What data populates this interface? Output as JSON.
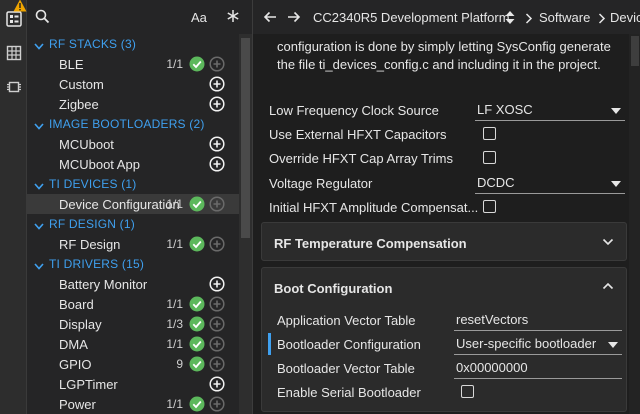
{
  "activity": {
    "items": [
      {
        "name": "Software",
        "icon": "component-tree-icon"
      },
      {
        "name": "Table",
        "icon": "table-icon"
      },
      {
        "name": "Chip",
        "icon": "chip-icon"
      }
    ],
    "warning_icon": "warning-icon"
  },
  "sidebar": {
    "case_toggle": "Aa",
    "groups": [
      {
        "label": "RF STACKS (3)",
        "items": [
          {
            "label": "BLE",
            "count": "1/1",
            "ok": true
          },
          {
            "label": "Custom",
            "count": "",
            "ok": false
          },
          {
            "label": "Zigbee",
            "count": "",
            "ok": false
          }
        ]
      },
      {
        "label": "IMAGE BOOTLOADERS (2)",
        "items": [
          {
            "label": "MCUboot",
            "count": "",
            "ok": false
          },
          {
            "label": "MCUboot App",
            "count": "",
            "ok": false
          }
        ]
      },
      {
        "label": "TI DEVICES (1)",
        "items": [
          {
            "label": "Device Configuration",
            "count": "1/1",
            "ok": true,
            "selected": true
          }
        ]
      },
      {
        "label": "RF DESIGN (1)",
        "items": [
          {
            "label": "RF Design",
            "count": "1/1",
            "ok": true
          }
        ]
      },
      {
        "label": "TI DRIVERS (15)",
        "items": [
          {
            "label": "Battery Monitor",
            "count": "",
            "ok": false
          },
          {
            "label": "Board",
            "count": "1/1",
            "ok": true
          },
          {
            "label": "Display",
            "count": "1/3",
            "ok": true
          },
          {
            "label": "DMA",
            "count": "1/1",
            "ok": true
          },
          {
            "label": "GPIO",
            "count": "9",
            "ok": true
          },
          {
            "label": "LGPTimer",
            "count": "",
            "ok": false
          },
          {
            "label": "Power",
            "count": "1/1",
            "ok": true
          }
        ]
      }
    ]
  },
  "topbar": {
    "board": "CC2340R5 Development Platform",
    "crumb1": "Software",
    "crumb2": "Device"
  },
  "content": {
    "intro": "configuration is done by simply letting SysConfig generate the file ti_devices_config.c and including it in the project.",
    "lf_clock_label": "Low Frequency Clock Source",
    "lf_clock_value": "LF XOSC",
    "ext_hfxt_label": "Use External HFXT Capacitors",
    "ext_hfxt_checked": false,
    "override_hfxt_label": "Override HFXT Cap Array Trims",
    "override_hfxt_checked": false,
    "voltage_reg_label": "Voltage Regulator",
    "voltage_reg_value": "DCDC",
    "initial_hfxt_label": "Initial HFXT Amplitude Compensat...",
    "initial_hfxt_checked": false,
    "rf_temp_title": "RF Temperature Compensation",
    "boot_title": "Boot Configuration",
    "app_vector_label": "Application Vector Table",
    "app_vector_value": "resetVectors",
    "bootloader_cfg_label": "Bootloader Configuration",
    "bootloader_cfg_value": "User-specific bootloader",
    "bootloader_vector_label": "Bootloader Vector Table",
    "bootloader_vector_value": "0x00000000",
    "serial_boot_label": "Enable Serial Bootloader",
    "serial_boot_checked": false
  },
  "colors": {
    "accent": "#3fa0ef",
    "ok_green": "#5cb85c",
    "warning": "#f0a500"
  }
}
